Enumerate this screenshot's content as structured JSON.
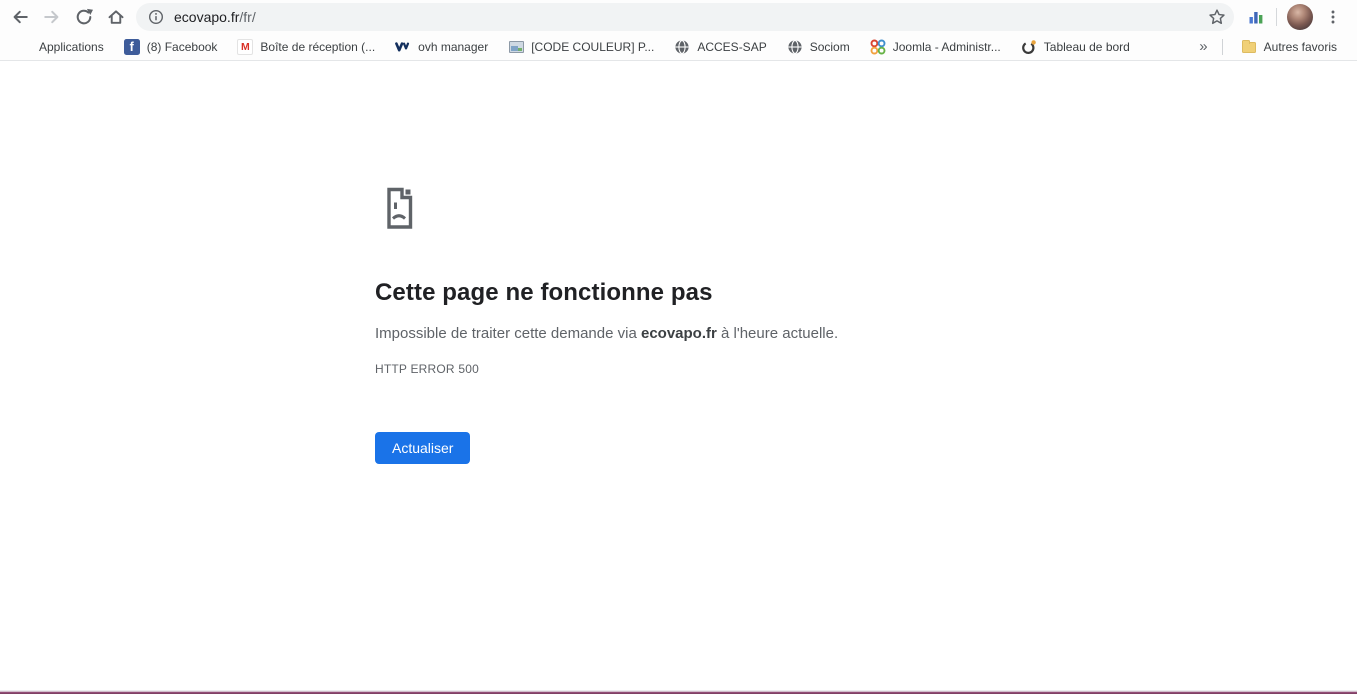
{
  "toolbar": {
    "url": {
      "host": "ecovapo.fr",
      "path": "/fr/"
    }
  },
  "bookmarks_bar": {
    "items": [
      {
        "label": "Applications",
        "icon": "apps-grid-icon"
      },
      {
        "label": "(8) Facebook",
        "icon": "facebook-icon"
      },
      {
        "label": "Boîte de réception (...",
        "icon": "gmail-icon"
      },
      {
        "label": "ovh manager",
        "icon": "ovh-icon"
      },
      {
        "label": "[CODE COULEUR] P...",
        "icon": "image-icon"
      },
      {
        "label": "ACCES-SAP",
        "icon": "globe-icon"
      },
      {
        "label": "Sociom",
        "icon": "globe-icon"
      },
      {
        "label": "Joomla - Administr...",
        "icon": "joomla-icon"
      },
      {
        "label": "Tableau de bord",
        "icon": "dashboard-icon"
      }
    ],
    "overflow_chevron": "»",
    "other_favorites_label": "Autres favoris"
  },
  "error_page": {
    "title": "Cette page ne fonctionne pas",
    "message": {
      "prefix": "Impossible de traiter cette demande via ",
      "host": "ecovapo.fr",
      "suffix": " à l'heure actuelle."
    },
    "error_code": "HTTP ERROR 500",
    "reload_button_label": "Actualiser"
  },
  "colors": {
    "accent_blue": "#1a73e8",
    "icon_gray": "#5f6368",
    "disabled_icon_gray": "#c5c8cc",
    "title_text": "#202124",
    "body_text": "#5f6368",
    "omnibox_bg": "#f1f3f4",
    "taskbar_accent": "#8e4770"
  }
}
